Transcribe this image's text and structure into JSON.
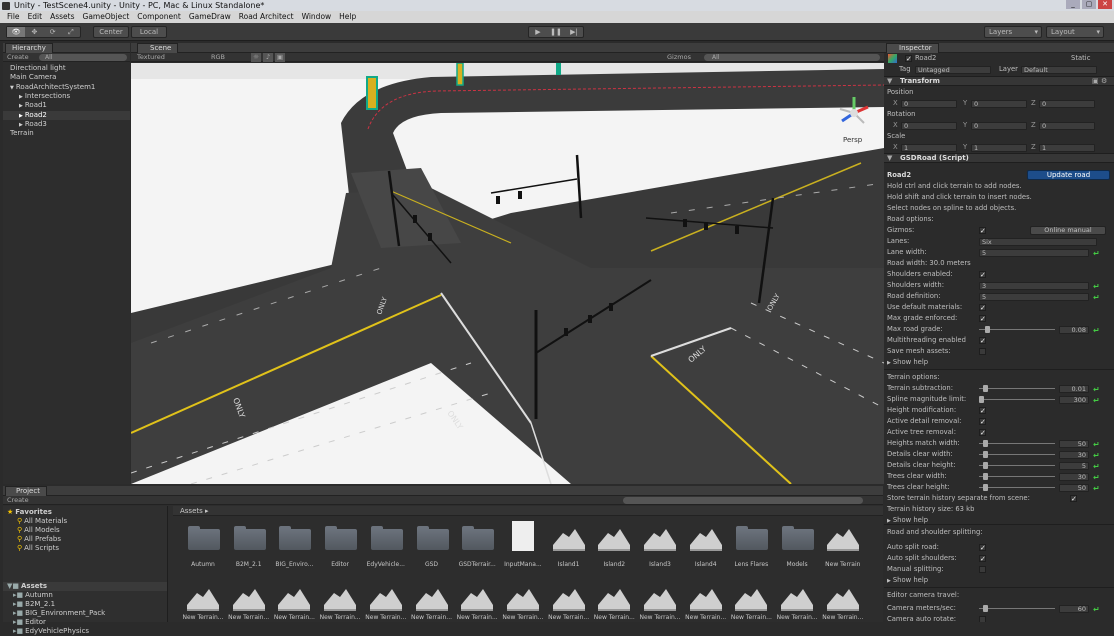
{
  "window": {
    "title": "Unity - TestScene4.unity - Unity - PC, Mac & Linux Standalone*",
    "controls": [
      "_",
      "▢",
      "✕"
    ]
  },
  "menu": [
    "File",
    "Edit",
    "Assets",
    "GameObject",
    "Component",
    "GameDraw",
    "Road Architect",
    "Window",
    "Help"
  ],
  "toolbar": {
    "pivot": "Center",
    "space": "Local",
    "layers": "Layers",
    "layout": "Layout"
  },
  "hierarchy": {
    "tab": "Hierarchy",
    "create": "Create",
    "search": "All",
    "items": [
      {
        "label": "Directional light",
        "indent": 0,
        "selected": false
      },
      {
        "label": "Main Camera",
        "indent": 0,
        "selected": false
      },
      {
        "label": "RoadArchitectSystem1",
        "indent": 0,
        "arrow": "▼",
        "selected": false
      },
      {
        "label": "Intersections",
        "indent": 1,
        "arrow": "▶",
        "selected": false
      },
      {
        "label": "Road1",
        "indent": 1,
        "arrow": "▶",
        "selected": false
      },
      {
        "label": "Road2",
        "indent": 1,
        "arrow": "▶",
        "selected": true
      },
      {
        "label": "Road3",
        "indent": 1,
        "arrow": "▶",
        "selected": false
      },
      {
        "label": "Terrain",
        "indent": 0,
        "selected": false
      }
    ]
  },
  "scene": {
    "tab": "Scene",
    "shading": "Textured",
    "render": "RGB",
    "gizmos": "Gizmos",
    "search": "All",
    "persp": "Persp",
    "road_labels": [
      "ONLY",
      "ONLY",
      "ONLY",
      "ONLY",
      "ONLY"
    ]
  },
  "inspector": {
    "tab": "Inspector",
    "object_name": "Road2",
    "static": "Static",
    "tag_label": "Tag",
    "tag": "Untagged",
    "layer_label": "Layer",
    "layer": "Default",
    "transform": {
      "header": "Transform",
      "position": {
        "label": "Position",
        "x": "0",
        "y": "0",
        "z": "0"
      },
      "rotation": {
        "label": "Rotation",
        "x": "0",
        "y": "0",
        "z": "0"
      },
      "scale": {
        "label": "Scale",
        "x": "1",
        "y": "1",
        "z": "1"
      }
    },
    "script": {
      "header": "GSDRoad (Script)",
      "name": "Road2",
      "update_button": "Update road",
      "help": [
        "Hold ctrl and click terrain to add nodes.",
        "Hold shift and click terrain to insert nodes.",
        "Select nodes on spline to add objects."
      ],
      "road_options_title": "Road options:",
      "online_manual": "Online manual",
      "gizmos": "Gizmos:",
      "lanes_label": "Lanes:",
      "lanes_value": "Six",
      "lane_width_label": "Lane width:",
      "lane_width_value": "5",
      "road_width_text": "Road width: 30.0 meters",
      "shoulders_enabled": "Shoulders enabled:",
      "shoulders_width_label": "Shoulders width:",
      "shoulders_width_value": "3",
      "road_definition_label": "Road definition:",
      "road_definition_value": "5",
      "use_default_materials": "Use default materials:",
      "max_grade_enforced": "Max grade enforced:",
      "max_road_grade_label": "Max road grade:",
      "max_road_grade_value": "0.08",
      "multithreading": "Multithreading enabled",
      "save_mesh": "Save mesh assets:",
      "show_help": "Show help",
      "terrain_options_title": "Terrain options:",
      "terrain_subtraction_label": "Terrain subtraction:",
      "terrain_subtraction_value": "0.01",
      "spline_mag_label": "Spline magnitude limit:",
      "spline_mag_value": "300",
      "height_mod": "Height modification:",
      "active_detail": "Active detail removal:",
      "active_tree": "Active tree removal:",
      "heights_match_label": "Heights match width:",
      "heights_match_value": "50",
      "details_clear_width_label": "Details clear width:",
      "details_clear_width_value": "30",
      "details_clear_height_label": "Details clear height:",
      "details_clear_height_value": "5",
      "trees_clear_width_label": "Trees clear width:",
      "trees_clear_width_value": "30",
      "trees_clear_height_label": "Trees clear height:",
      "trees_clear_height_value": "50",
      "store_history": "Store terrain history separate from scene:",
      "history_size": "Terrain history size: 63 kb",
      "road_shoulder_title": "Road and shoulder splitting:",
      "auto_split_road": "Auto split road:",
      "auto_split_shoulders": "Auto split shoulders:",
      "manual_splitting": "Manual splitting:",
      "camera_travel_title": "Editor camera travel:",
      "camera_meters_label": "Camera meters/sec:",
      "camera_meters_value": "60",
      "camera_auto_rotate": "Camera auto rotate:"
    }
  },
  "project": {
    "tab": "Project",
    "create": "Create",
    "favorites": {
      "label": "Favorites",
      "items": [
        "All Materials",
        "All Models",
        "All Prefabs",
        "All Scripts"
      ]
    },
    "assets_tree": {
      "label": "Assets",
      "items": [
        "Autumn",
        "B2M_2.1",
        "BIG_Environment_Pack",
        "Editor",
        "EdyVehiclePhysics",
        "GSD"
      ]
    },
    "breadcrumb": "Assets",
    "grid_row1": [
      "Autumn",
      "B2M_2.1",
      "BIG_Enviro...",
      "Editor",
      "EdyVehicle...",
      "GSD",
      "GSDTerrair...",
      "InputMana...",
      "Island1",
      "Island2",
      "Island3",
      "Island4",
      "Lens Flares",
      "Models",
      "New Terrain"
    ],
    "grid_row2": [
      "New Terrain...",
      "New Terrain...",
      "New Terrain...",
      "New Terrain...",
      "New Terrain...",
      "New Terrain...",
      "New Terrain...",
      "New Terrain...",
      "New Terrain...",
      "New Terrain...",
      "New Terrain...",
      "New Terrain...",
      "New Terrain...",
      "New Terrain...",
      "New Terrain..."
    ]
  }
}
